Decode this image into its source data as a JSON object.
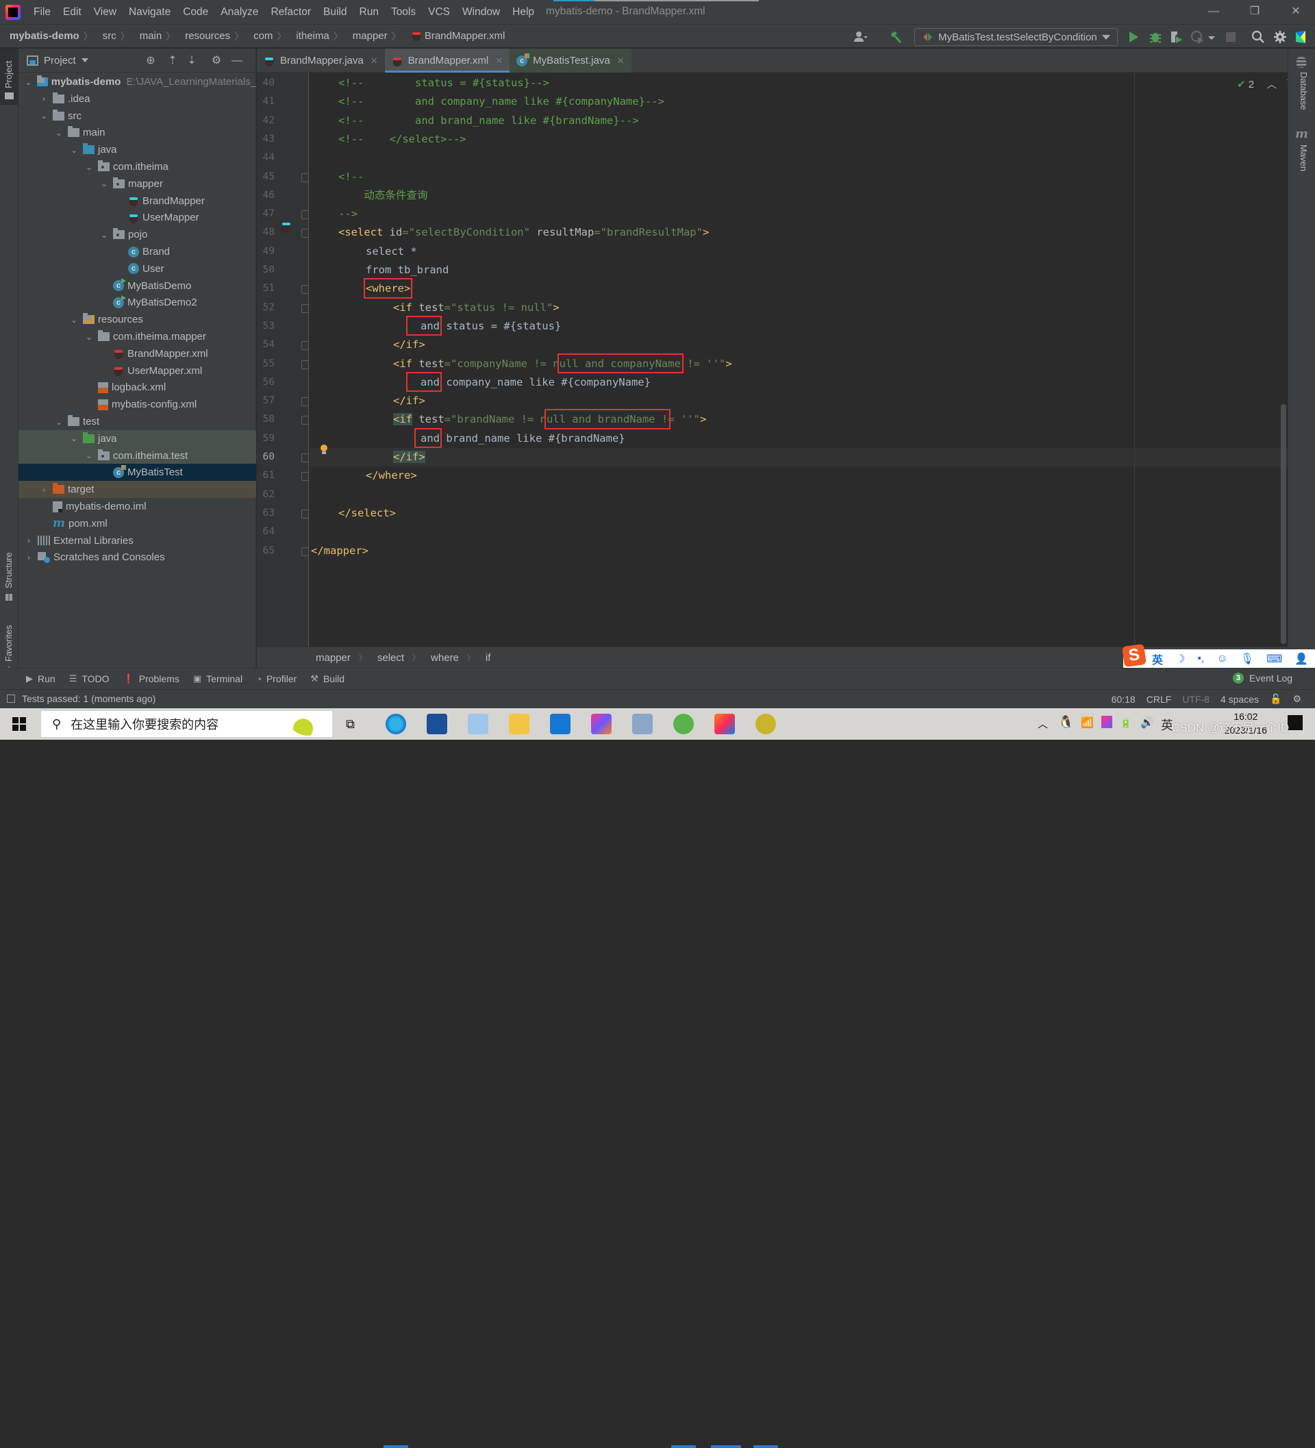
{
  "app": {
    "window_title": "mybatis-demo - BrandMapper.xml",
    "menu": [
      "File",
      "Edit",
      "View",
      "Navigate",
      "Code",
      "Analyze",
      "Refactor",
      "Build",
      "Run",
      "Tools",
      "VCS",
      "Window",
      "Help"
    ],
    "progress_fraction": 0.2
  },
  "navbar": {
    "breadcrumb": [
      "mybatis-demo",
      "src",
      "main",
      "resources",
      "com",
      "itheima",
      "mapper",
      "BrandMapper.xml"
    ],
    "run_config": "MyBatisTest.testSelectByCondition"
  },
  "left_stripe": {
    "project": "Project",
    "structure": "Structure",
    "favorites": "Favorites"
  },
  "right_stripe": {
    "database": "Database",
    "maven": "Maven"
  },
  "project_panel": {
    "title": "Project",
    "tree": [
      {
        "label": "mybatis-demo",
        "hint": "E:\\JAVA_LearningMaterials_",
        "depth": 0,
        "arrow": "down",
        "icon": "module-folder",
        "bold": true
      },
      {
        "label": ".idea",
        "depth": 1,
        "arrow": "right",
        "icon": "folder"
      },
      {
        "label": "src",
        "depth": 1,
        "arrow": "down",
        "icon": "folder"
      },
      {
        "label": "main",
        "depth": 2,
        "arrow": "down",
        "icon": "folder"
      },
      {
        "label": "java",
        "depth": 3,
        "arrow": "down",
        "icon": "source-folder"
      },
      {
        "label": "com.itheima",
        "depth": 4,
        "arrow": "down",
        "icon": "package"
      },
      {
        "label": "mapper",
        "depth": 5,
        "arrow": "down",
        "icon": "package"
      },
      {
        "label": "BrandMapper",
        "depth": 6,
        "arrow": "",
        "icon": "mybatis-java"
      },
      {
        "label": "UserMapper",
        "depth": 6,
        "arrow": "",
        "icon": "mybatis-java"
      },
      {
        "label": "pojo",
        "depth": 5,
        "arrow": "down",
        "icon": "package"
      },
      {
        "label": "Brand",
        "depth": 6,
        "arrow": "",
        "icon": "class"
      },
      {
        "label": "User",
        "depth": 6,
        "arrow": "",
        "icon": "class"
      },
      {
        "label": "MyBatisDemo",
        "depth": 5,
        "arrow": "",
        "icon": "class-run"
      },
      {
        "label": "MyBatisDemo2",
        "depth": 5,
        "arrow": "",
        "icon": "class-run"
      },
      {
        "label": "resources",
        "depth": 3,
        "arrow": "down",
        "icon": "resources-folder"
      },
      {
        "label": "com.itheima.mapper",
        "depth": 4,
        "arrow": "down",
        "icon": "folder"
      },
      {
        "label": "BrandMapper.xml",
        "depth": 5,
        "arrow": "",
        "icon": "mybatis-xml"
      },
      {
        "label": "UserMapper.xml",
        "depth": 5,
        "arrow": "",
        "icon": "mybatis-xml"
      },
      {
        "label": "logback.xml",
        "depth": 4,
        "arrow": "",
        "icon": "xml-file"
      },
      {
        "label": "mybatis-config.xml",
        "depth": 4,
        "arrow": "",
        "icon": "xml-file"
      },
      {
        "label": "test",
        "depth": 2,
        "arrow": "down",
        "icon": "folder"
      },
      {
        "label": "java",
        "depth": 3,
        "arrow": "down",
        "icon": "test-folder",
        "state": "green"
      },
      {
        "label": "com.itheima.test",
        "depth": 4,
        "arrow": "down",
        "icon": "package",
        "state": "green"
      },
      {
        "label": "MyBatisTest",
        "depth": 5,
        "arrow": "",
        "icon": "class-test",
        "state": "selected"
      },
      {
        "label": "target",
        "depth": 1,
        "arrow": "right",
        "icon": "excluded-folder",
        "state": "excluded"
      },
      {
        "label": "mybatis-demo.iml",
        "depth": 1,
        "arrow": "",
        "icon": "iml-file"
      },
      {
        "label": "pom.xml",
        "depth": 1,
        "arrow": "",
        "icon": "maven-file"
      },
      {
        "label": "External Libraries",
        "depth": 0,
        "arrow": "right",
        "icon": "libraries"
      },
      {
        "label": "Scratches and Consoles",
        "depth": 0,
        "arrow": "right",
        "icon": "scratches"
      }
    ]
  },
  "editor": {
    "tabs": [
      {
        "label": "BrandMapper.java",
        "icon": "mybatis-java",
        "active": false
      },
      {
        "label": "BrandMapper.xml",
        "icon": "mybatis-xml",
        "active": true
      },
      {
        "label": "MyBatisTest.java",
        "icon": "class-test",
        "active": false
      }
    ],
    "current_line": 60,
    "inspection_count": "2",
    "lines": [
      {
        "n": 40,
        "html": "<span class='c-comment'>&lt;!--        status = #{status}--&gt;</span>",
        "indent": 1
      },
      {
        "n": 41,
        "html": "<span class='c-comment'>&lt;!--        and company_name like #{companyName}--&gt;</span>",
        "indent": 1
      },
      {
        "n": 42,
        "html": "<span class='c-comment'>&lt;!--        and brand_name like #{brandName}--&gt;</span>",
        "indent": 1
      },
      {
        "n": 43,
        "html": "<span class='c-comment'>&lt;!--    &lt;/select&gt;--&gt;</span>",
        "indent": 1
      },
      {
        "n": 44,
        "html": "",
        "indent": 0
      },
      {
        "n": 45,
        "html": "<span class='c-comment'>&lt;!--</span>",
        "indent": 1,
        "fold": true
      },
      {
        "n": 46,
        "html": "<span class='c-comment'>    动态条件查询</span>",
        "indent": 1
      },
      {
        "n": 47,
        "html": "<span class='c-comment'>--&gt;</span>",
        "indent": 1,
        "fold": true
      },
      {
        "n": 48,
        "html": "<span class='c-tag'>&lt;select </span><span class='c-attr'>id</span><span class='c-val'>=\"selectByCondition\" </span><span class='c-attr'>resultMap</span><span class='c-val'>=\"brandResultMap\"</span><span class='c-tag'>&gt;</span>",
        "indent": 1,
        "fold": true
      },
      {
        "n": 49,
        "html": "<span class='c-text'>select *</span>",
        "indent": 2
      },
      {
        "n": 50,
        "html": "<span class='c-text'>from tb_brand</span>",
        "indent": 2
      },
      {
        "n": 51,
        "html": "<span class='c-tag'>&lt;where&gt;</span>",
        "indent": 2,
        "fold": true
      },
      {
        "n": 52,
        "html": "<span class='c-tag'>&lt;if </span><span class='c-attr'>test</span><span class='c-val'>=\"status != null\"</span><span class='c-tag'>&gt;</span>",
        "indent": 3,
        "fold": true
      },
      {
        "n": 53,
        "html": "<span class='c-text'>and status = #{status}</span>",
        "indent": 4
      },
      {
        "n": 54,
        "html": "<span class='c-tag'>&lt;/if&gt;</span>",
        "indent": 3,
        "fold": true
      },
      {
        "n": 55,
        "html": "<span class='c-tag'>&lt;if </span><span class='c-attr'>test</span><span class='c-val'>=\"companyName != null and companyName != ''\"</span><span class='c-tag'>&gt;</span>",
        "indent": 3,
        "fold": true
      },
      {
        "n": 56,
        "html": "<span class='c-text'>and company_name like #{companyName}</span>",
        "indent": 4
      },
      {
        "n": 57,
        "html": "<span class='c-tag'>&lt;/if&gt;</span>",
        "indent": 3,
        "fold": true
      },
      {
        "n": 58,
        "html": "<span class='c-tag brace-hl'>&lt;if</span><span class='c-attr'> test</span><span class='c-val'>=\"brandName != null and brandName != ''\"</span><span class='c-tag'>&gt;</span>",
        "indent": 3,
        "fold": true
      },
      {
        "n": 59,
        "html": "<span class='c-text'>and brand_name like #{brandName}</span>",
        "indent": 4
      },
      {
        "n": 60,
        "html": "<span class='c-tag brace-hl'>&lt;/if&gt;</span>",
        "indent": 3,
        "fold": true
      },
      {
        "n": 61,
        "html": "<span class='c-tag'>&lt;/where&gt;</span>",
        "indent": 2,
        "fold": true
      },
      {
        "n": 62,
        "html": "",
        "indent": 0
      },
      {
        "n": 63,
        "html": "<span class='c-tag'>&lt;/select&gt;</span>",
        "indent": 1,
        "fold": true
      },
      {
        "n": 64,
        "html": "",
        "indent": 0
      },
      {
        "n": 65,
        "html": "<span class='c-tag'>&lt;/mapper&gt;</span>",
        "indent": 0,
        "fold": true
      }
    ],
    "breadcrumbs": [
      "mapper",
      "select",
      "where",
      "if"
    ]
  },
  "tool_windows": [
    "Run",
    "TODO",
    "Problems",
    "Terminal",
    "Profiler",
    "Build"
  ],
  "event_log": {
    "label": "Event Log",
    "count": "3"
  },
  "status": {
    "message": "Tests passed: 1 (moments ago)",
    "position": "60:18",
    "line_sep": "CRLF",
    "encoding": "UTF-8",
    "indent": "4 spaces"
  },
  "ime": {
    "mode": "英"
  },
  "taskbar": {
    "search_placeholder": "在这里输入你要搜索的内容",
    "time": "16:02",
    "date": "2023/1/16",
    "tray_ime": "英"
  },
  "watermark": "CSDN @这不是一个ID"
}
